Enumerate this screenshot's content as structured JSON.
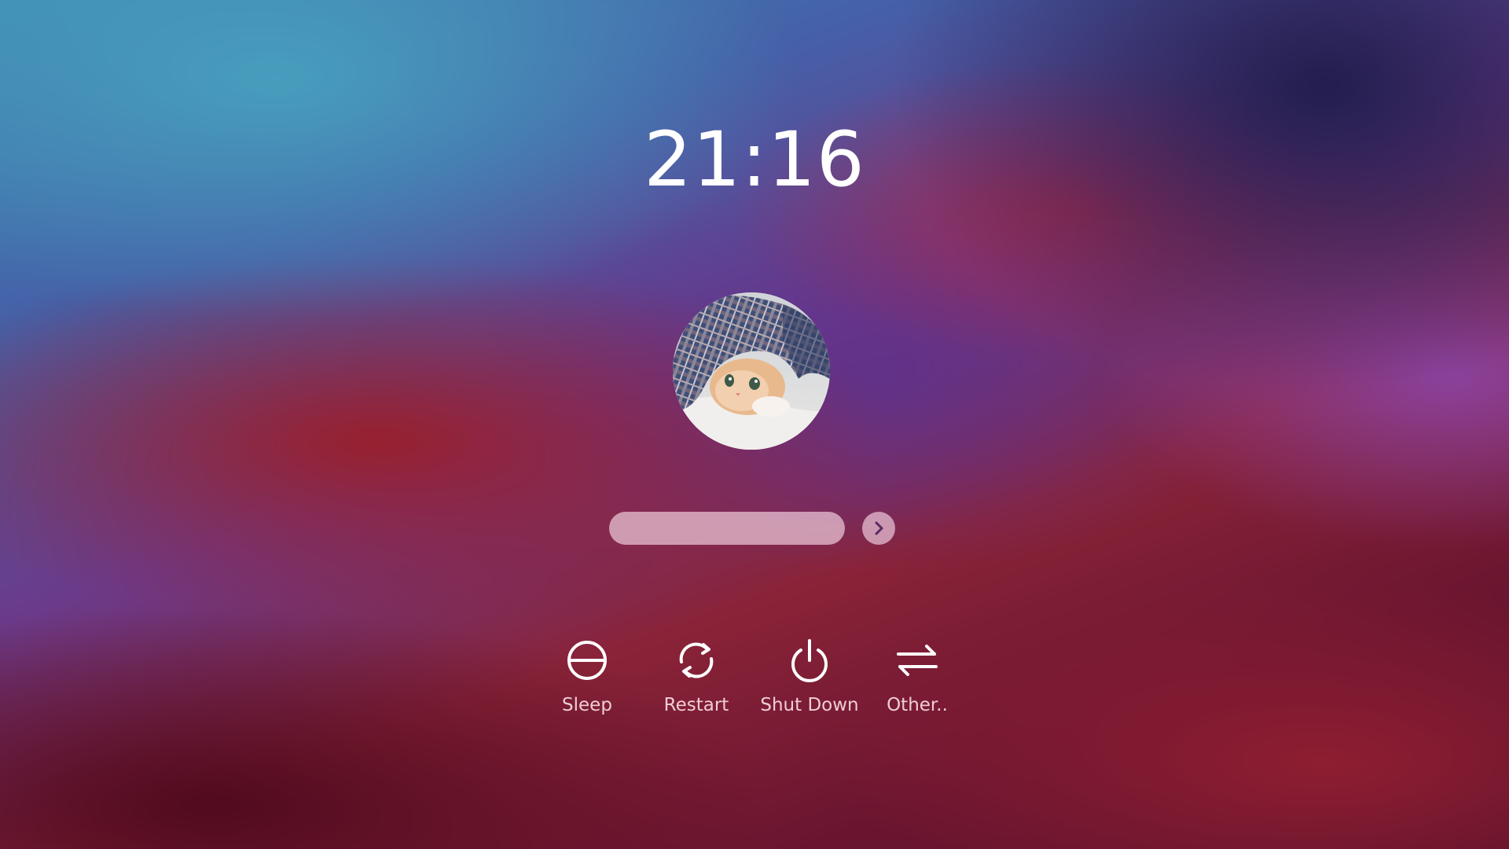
{
  "clock": {
    "time": "21:16"
  },
  "user": {
    "avatar_description": "kitten-under-blanket"
  },
  "login": {
    "password_value": "",
    "password_placeholder": "",
    "submit_icon": "chevron-right-icon"
  },
  "power_actions": [
    {
      "label": "Sleep",
      "icon": "sleep-icon"
    },
    {
      "label": "Restart",
      "icon": "restart-icon"
    },
    {
      "label": "Shut Down",
      "icon": "power-icon"
    },
    {
      "label": "Other..",
      "icon": "switch-arrows-icon"
    }
  ],
  "colors": {
    "text": "#ffffff",
    "field": "#ebc8d7",
    "accent": "#5a2a5e"
  }
}
